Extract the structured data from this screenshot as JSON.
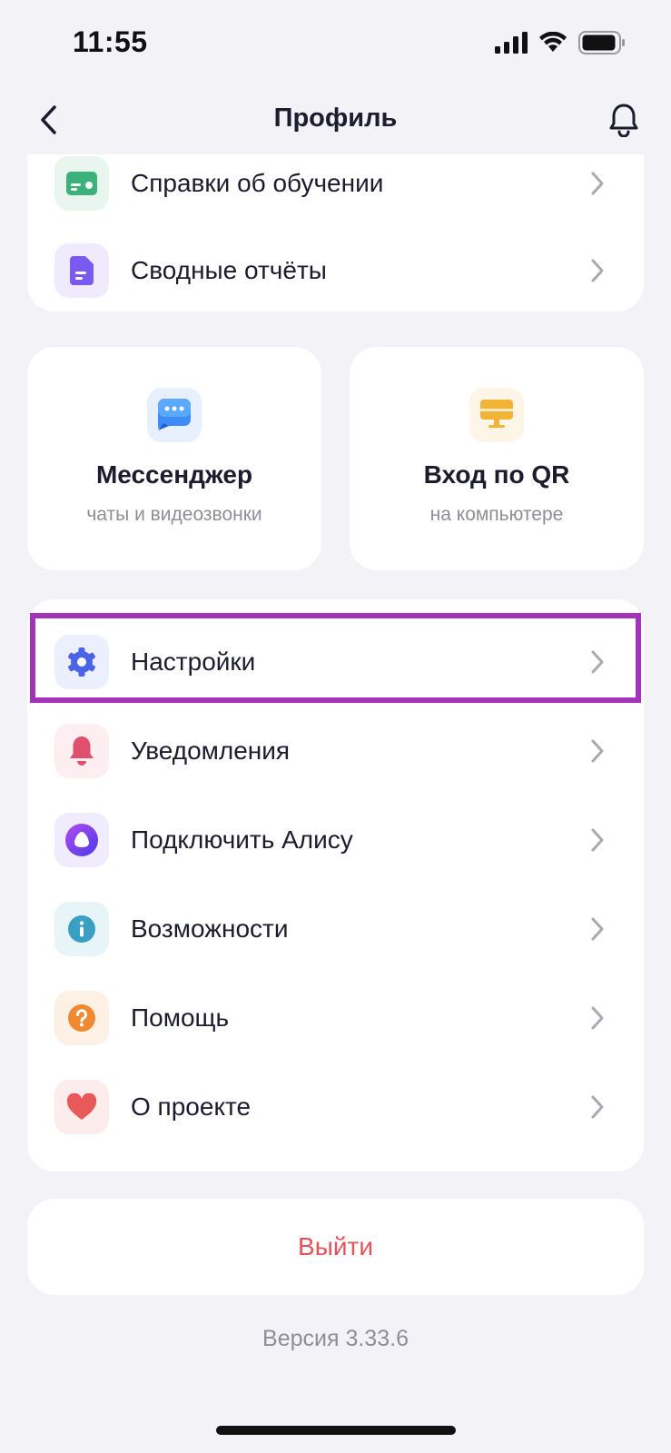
{
  "status_bar": {
    "time": "11:55"
  },
  "header": {
    "title": "Профиль"
  },
  "top_list": [
    {
      "label": "Справки об обучении",
      "icon": "certificate-icon",
      "color": "#3ab27a",
      "bg": "#e8f6ef"
    },
    {
      "label": "Сводные отчёты",
      "icon": "report-icon",
      "color": "#7a5af0",
      "bg": "#efebfd"
    }
  ],
  "tiles": {
    "messenger": {
      "title": "Мессенджер",
      "subtitle": "чаты и видеозвонки",
      "icon": "chat-icon",
      "bg": "#e9f0fd"
    },
    "qr_login": {
      "title": "Вход по QR",
      "subtitle": "на компьютере",
      "icon": "computer-icon",
      "bg": "#fdf6e6"
    }
  },
  "menu": [
    {
      "label": "Настройки",
      "icon": "gear-icon",
      "color": "#4a64e8",
      "bg": "#eceffd"
    },
    {
      "label": "Уведомления",
      "icon": "bell-icon",
      "color": "#e0506e",
      "bg": "#fdeef1"
    },
    {
      "label": "Подключить Алису",
      "icon": "alice-icon",
      "color": "#7a3ef0",
      "bg": "#f1ecfd"
    },
    {
      "label": "Возможности",
      "icon": "info-icon",
      "color": "#3a9fc0",
      "bg": "#e8f5f8"
    },
    {
      "label": "Помощь",
      "icon": "help-icon",
      "color": "#f08a30",
      "bg": "#fdf1e6"
    },
    {
      "label": "О проекте",
      "icon": "heart-icon",
      "color": "#e85a5a",
      "bg": "#fdecec"
    }
  ],
  "logout": {
    "label": "Выйти",
    "color": "#e3545a"
  },
  "version": "Версия 3.33.6",
  "accent_highlight": "#a333b8"
}
